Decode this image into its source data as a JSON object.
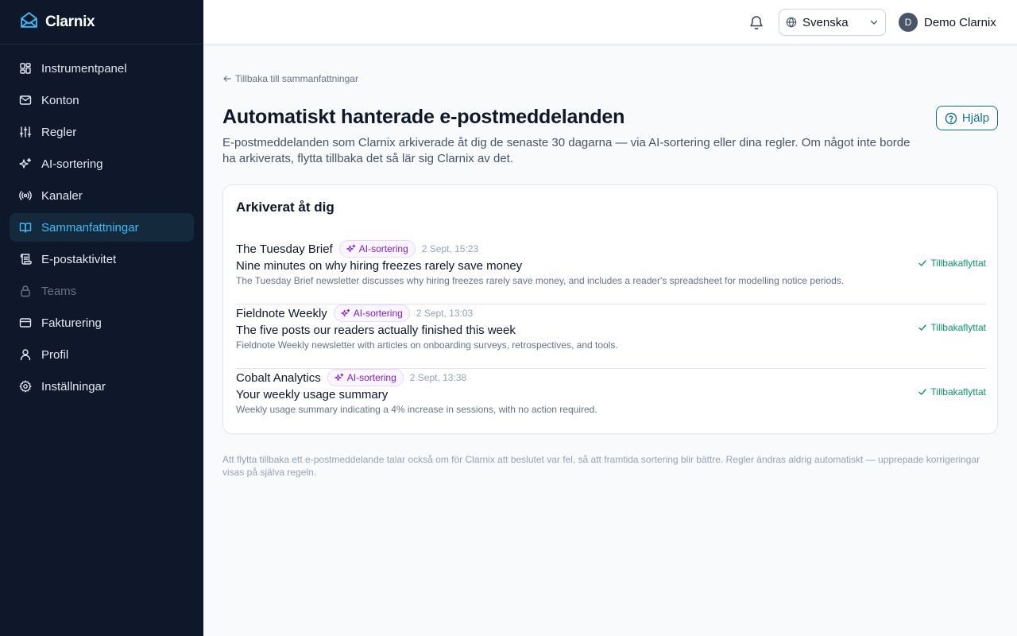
{
  "app": {
    "name": "Clarnix",
    "accent": "#38bdf8",
    "sidebar_bg": "#0f172a"
  },
  "sidebar": {
    "items": [
      {
        "label": "Instrumentpanel",
        "icon": "dashboard-icon",
        "active": false,
        "disabled": false
      },
      {
        "label": "Konton",
        "icon": "mail-icon",
        "active": false,
        "disabled": false
      },
      {
        "label": "Regler",
        "icon": "sliders-icon",
        "active": false,
        "disabled": false
      },
      {
        "label": "AI-sortering",
        "icon": "sparkles-icon",
        "active": false,
        "disabled": false
      },
      {
        "label": "Kanaler",
        "icon": "radio-icon",
        "active": false,
        "disabled": false
      },
      {
        "label": "Sammanfattningar",
        "icon": "book-open-icon",
        "active": true,
        "disabled": false
      },
      {
        "label": "E-postaktivitet",
        "icon": "scroll-icon",
        "active": false,
        "disabled": false
      },
      {
        "label": "Teams",
        "icon": "lock-icon",
        "active": false,
        "disabled": true
      },
      {
        "label": "Fakturering",
        "icon": "credit-card-icon",
        "active": false,
        "disabled": false
      },
      {
        "label": "Profil",
        "icon": "user-icon",
        "active": false,
        "disabled": false
      },
      {
        "label": "Inställningar",
        "icon": "gear-icon",
        "active": false,
        "disabled": false
      }
    ]
  },
  "header": {
    "language": "Svenska",
    "user": {
      "initial": "D",
      "name": "Demo Clarnix"
    }
  },
  "main": {
    "back_link": "Tillbaka till sammanfattningar",
    "title": "Automatiskt hanterade e-postmeddelanden",
    "subtitle": "E-postmeddelanden som Clarnix arkiverade åt dig de senaste 30 dagarna — via AI-sortering eller dina regler. Om något inte borde ha arkiverats, flytta tillbaka det så lär sig Clarnix av det.",
    "help_label": "Hjälp",
    "card": {
      "title": "Arkiverat åt dig",
      "emails": [
        {
          "sender": "The Tuesday Brief",
          "badge": "AI-sortering",
          "date": "2 Sept, 15:23",
          "subject": "Nine minutes on why hiring freezes rarely save money",
          "summary": "The Tuesday Brief newsletter discusses why hiring freezes rarely save money, and includes a reader's spreadsheet for modelling notice periods.",
          "status": "Tillbakaflyttat"
        },
        {
          "sender": "Fieldnote Weekly",
          "badge": "AI-sortering",
          "date": "2 Sept, 13:03",
          "subject": "The five posts our readers actually finished this week",
          "summary": "Fieldnote Weekly newsletter with articles on onboarding surveys, retrospectives, and tools.",
          "status": "Tillbakaflyttat"
        },
        {
          "sender": "Cobalt Analytics",
          "badge": "AI-sortering",
          "date": "2 Sept, 13:38",
          "subject": "Your weekly usage summary",
          "summary": "Weekly usage summary indicating a 4% increase in sessions, with no action required.",
          "status": "Tillbakaflyttat"
        }
      ]
    },
    "footnote": "Att flytta tillbaka ett e-postmeddelande talar också om för Clarnix att beslutet var fel, så att framtida sortering blir bättre. Regler ändras aldrig automatiskt — upprepade korrigeringar visas på själva regeln."
  }
}
